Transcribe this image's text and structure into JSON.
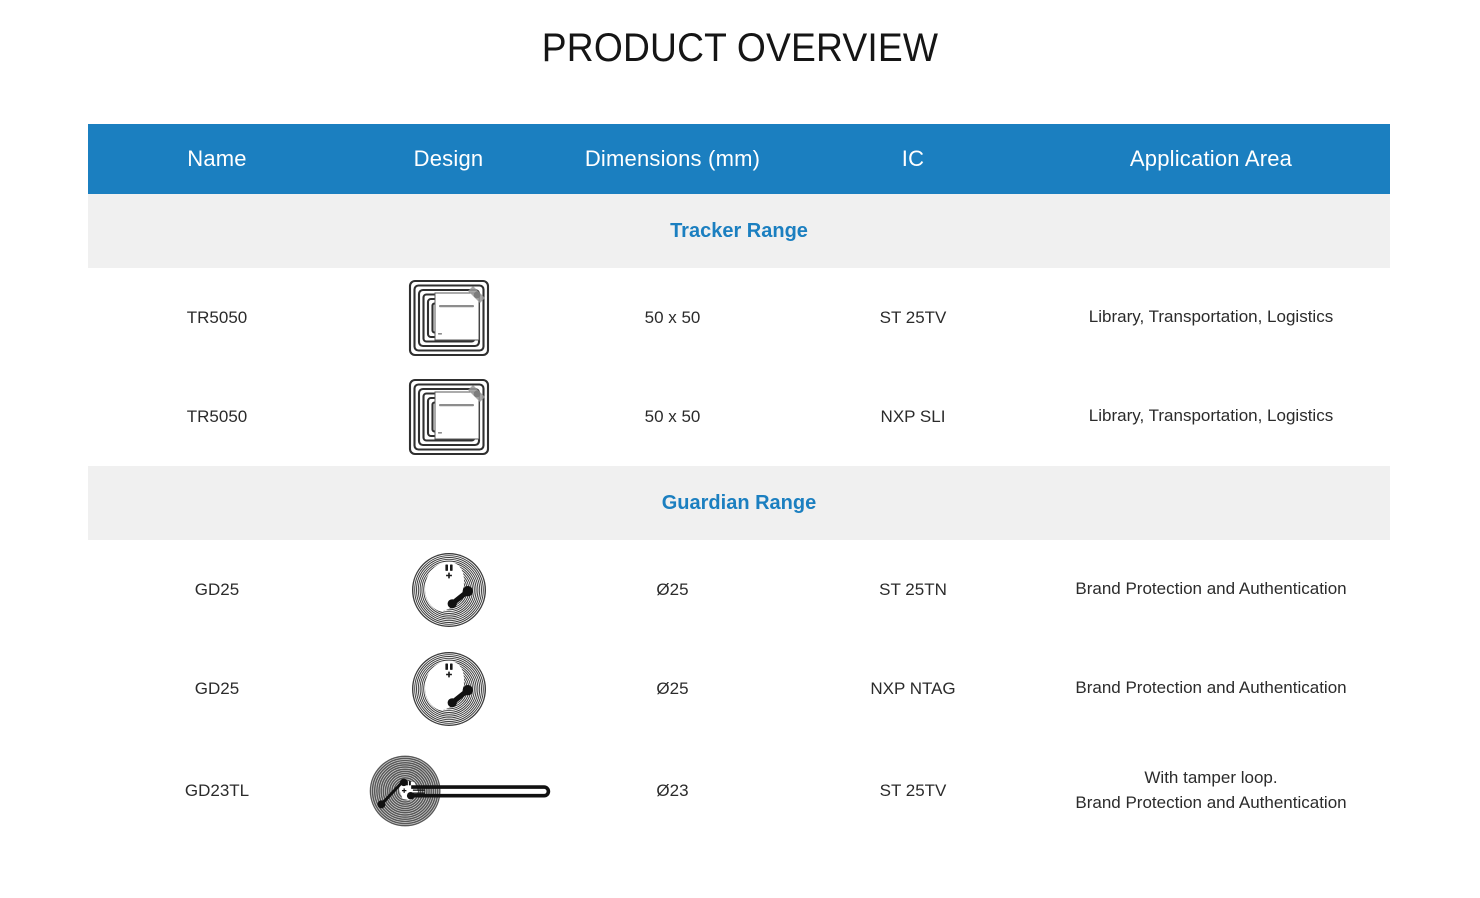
{
  "page": {
    "title": "PRODUCT OVERVIEW",
    "accent_color": "#1b7fc0",
    "section_band_color": "#f0f0f0",
    "text_color": "#2b2b2b",
    "background": "#ffffff"
  },
  "table": {
    "columns": [
      {
        "key": "name",
        "label": "Name"
      },
      {
        "key": "design",
        "label": "Design"
      },
      {
        "key": "dimensions",
        "label": "Dimensions (mm)"
      },
      {
        "key": "ic",
        "label": "IC"
      },
      {
        "key": "application",
        "label": "Application Area"
      }
    ],
    "sections": [
      {
        "id": "tracker",
        "label": "Tracker Range",
        "rows": [
          {
            "name": "TR5050",
            "design_icon": "square-inlay-tag-icon",
            "dimensions": "50 x 50",
            "ic": "ST 25TV",
            "application": [
              "Library, Transportation, Logistics"
            ]
          },
          {
            "name": "TR5050",
            "design_icon": "square-inlay-tag-icon",
            "dimensions": "50 x 50",
            "ic": "NXP SLI",
            "application": [
              "Library, Transportation, Logistics"
            ]
          }
        ]
      },
      {
        "id": "guardian",
        "label": "Guardian Range",
        "rows": [
          {
            "name": "GD25",
            "design_icon": "round-nfc-tag-icon",
            "dimensions": "Ø25",
            "ic": "ST 25TN",
            "application": [
              "Brand Protection and Authentication"
            ]
          },
          {
            "name": "GD25",
            "design_icon": "round-nfc-tag-icon",
            "dimensions": "Ø25",
            "ic": "NXP NTAG",
            "application": [
              "Brand Protection and Authentication"
            ]
          },
          {
            "name": "GD23TL",
            "design_icon": "round-tamper-loop-tag-icon",
            "dimensions": "Ø23",
            "ic": "ST 25TV",
            "application": [
              "With tamper loop.",
              "Brand Protection and Authentication"
            ]
          }
        ]
      }
    ]
  }
}
